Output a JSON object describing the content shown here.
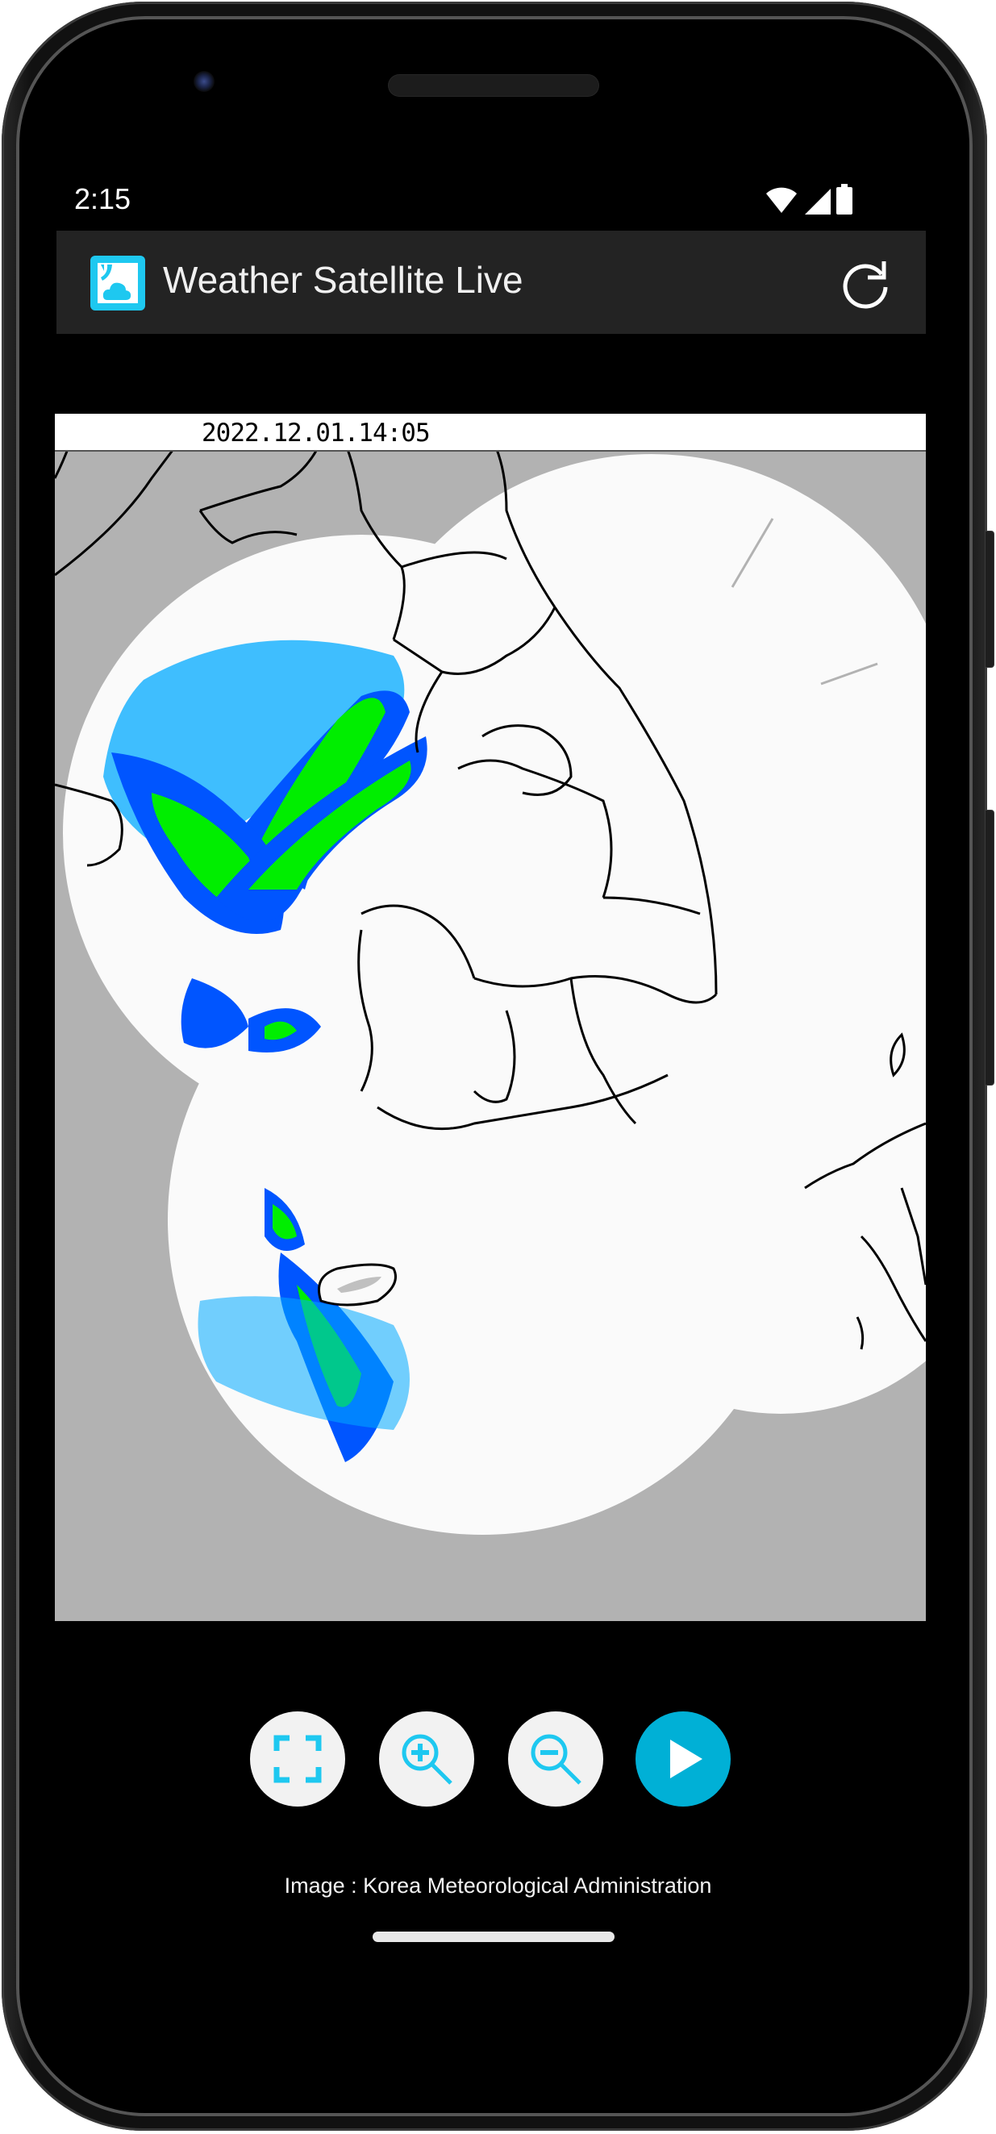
{
  "status_bar": {
    "time": "2:15",
    "icons": [
      "wifi-icon",
      "cell-signal-icon",
      "battery-icon"
    ]
  },
  "app_bar": {
    "icon": "weather-radar-app-icon",
    "title": "Weather Satellite Live",
    "refresh_icon": "refresh-icon"
  },
  "radar": {
    "timestamp": "2022.12.01.14:05",
    "colors": {
      "no_coverage": "#b2b2b2",
      "coverage": "#fafafa",
      "light_rain": "#00aaff",
      "moderate_rain": "#0055ff",
      "heavy_rain_blue": "#0000cc",
      "green": "#00ee00",
      "dark_green": "#009900",
      "border": "#000000"
    }
  },
  "controls": [
    {
      "name": "fullscreen",
      "icon": "fullscreen-icon"
    },
    {
      "name": "zoom-in",
      "icon": "zoom-in-icon"
    },
    {
      "name": "zoom-out",
      "icon": "zoom-out-icon"
    },
    {
      "name": "play",
      "icon": "play-icon"
    }
  ],
  "accent_color": "#00b0d6",
  "icon_color": "#1ec8f0",
  "credit": "Image : Korea Meteorological Administration"
}
